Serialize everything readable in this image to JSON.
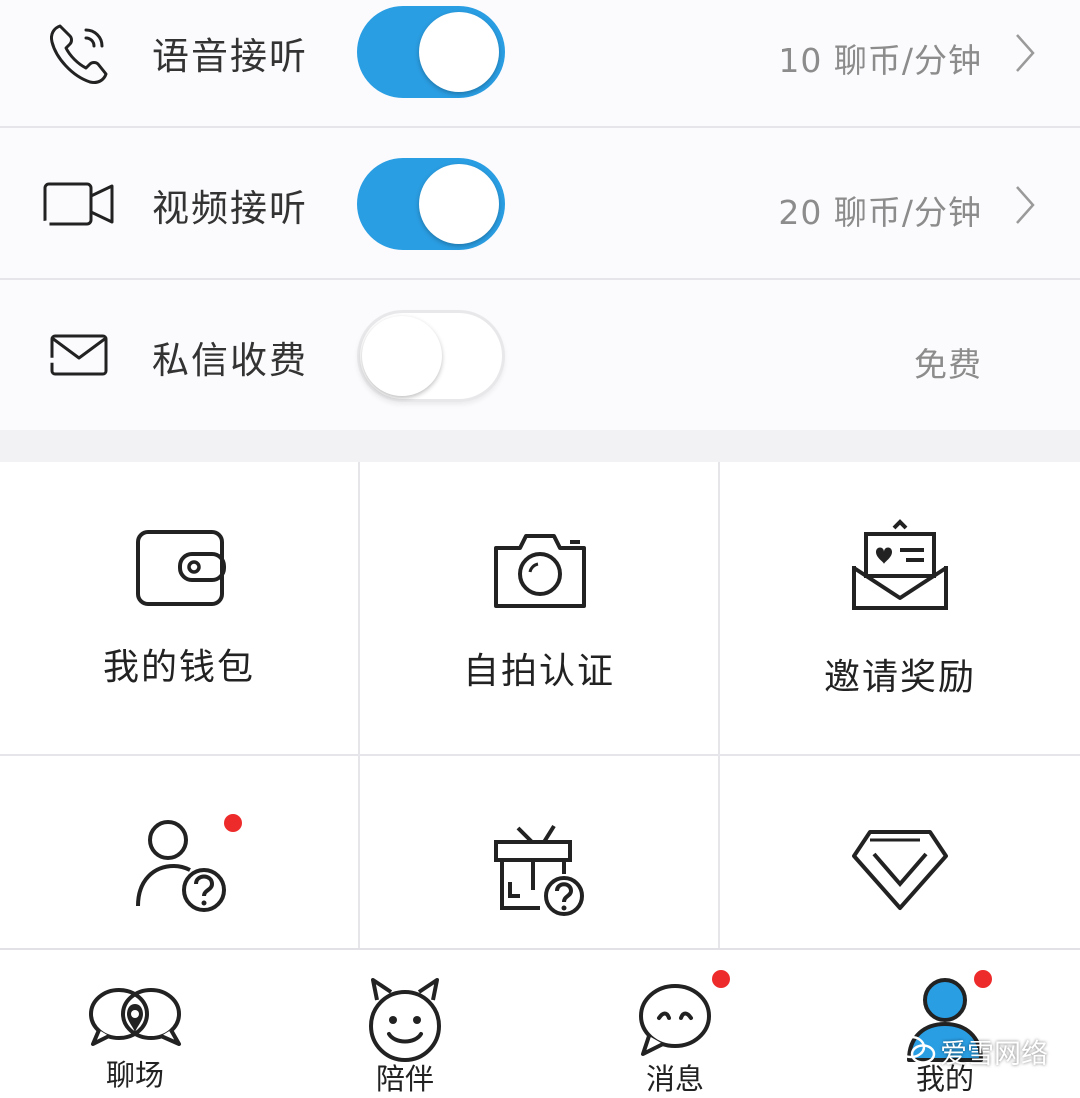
{
  "settings": [
    {
      "label": "语音接听",
      "price": "10 聊币/分钟",
      "enabled": true,
      "icon": "phone-icon",
      "has_chevron": true
    },
    {
      "label": "视频接听",
      "price": "20 聊币/分钟",
      "enabled": true,
      "icon": "video-camera-icon",
      "has_chevron": true
    },
    {
      "label": "私信收费",
      "price": "免费",
      "enabled": false,
      "icon": "envelope-icon",
      "has_chevron": false
    }
  ],
  "grid": [
    {
      "label": "我的钱包",
      "icon": "wallet-icon"
    },
    {
      "label": "自拍认证",
      "icon": "camera-icon"
    },
    {
      "label": "邀请奖励",
      "icon": "invite-letter-icon"
    },
    {
      "label": "",
      "icon": "user-question-icon",
      "badge": true
    },
    {
      "label": "",
      "icon": "gift-question-icon"
    },
    {
      "label": "",
      "icon": "diamond-icon"
    }
  ],
  "tabs": [
    {
      "label": "聊场",
      "icon": "chat-bubbles-icon"
    },
    {
      "label": "陪伴",
      "icon": "devil-face-icon"
    },
    {
      "label": "消息",
      "icon": "message-bubble-icon",
      "badge": true
    },
    {
      "label": "我的",
      "icon": "profile-icon",
      "badge": true,
      "active": true
    }
  ],
  "watermark": "爱雪网络",
  "colors": {
    "accent": "#2a9ee3",
    "badge": "#ee2b2b"
  }
}
